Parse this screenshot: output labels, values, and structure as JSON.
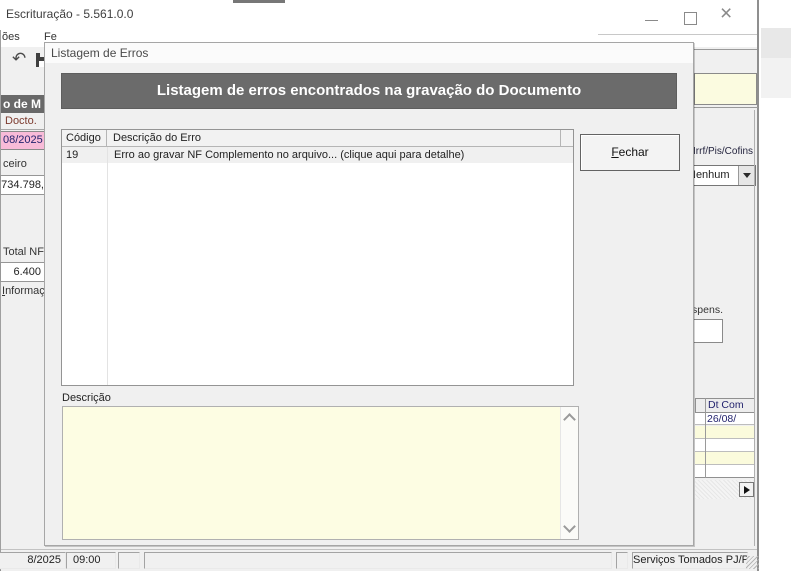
{
  "window": {
    "title": "Escrituração - 5.561.0.0"
  },
  "menu": {
    "item1": "ões",
    "item2": "Fe"
  },
  "dialog": {
    "title": "Listagem de Erros",
    "banner": "Listagem de erros encontrados na gravação do Documento",
    "grid": {
      "col_codigo": "Código",
      "col_descricao": "Descrição do Erro",
      "rows": [
        {
          "codigo": "19",
          "descricao": "Erro ao gravar NF Complemento no arquivo... (clique aqui para detalhe)"
        }
      ]
    },
    "close_button": {
      "mnemonic": "F",
      "rest": "echar"
    },
    "descricao_label": "Descrição",
    "descricao_value": ""
  },
  "left_panel": {
    "band": "o de M",
    "docto_label": "Docto.",
    "competencia": "08/2025",
    "ceiro_label": "ceiro",
    "valor1": "734.798,",
    "total_nf_label": "Total NF",
    "valor2": "6.400",
    "informac": {
      "mnemonic": "I",
      "rest": "nformaç"
    }
  },
  "right_panel": {
    "irrf_label": "Irrf/Pis/Cofins",
    "combo_value": "Nenhum",
    "suspens_label": "Suspens.",
    "grid_col": "Dt Com",
    "grid_row1": "26/08/"
  },
  "statusbar": {
    "date": "8/2025",
    "time": "09:00",
    "mode": "Serviços Tomados PJ/P"
  },
  "colors": {
    "banner_bg": "#6b6b6b",
    "competencia_pink": "#f8bbd8",
    "field_yellow": "#fdfde3",
    "row_yellow": "#fbfbdc"
  }
}
